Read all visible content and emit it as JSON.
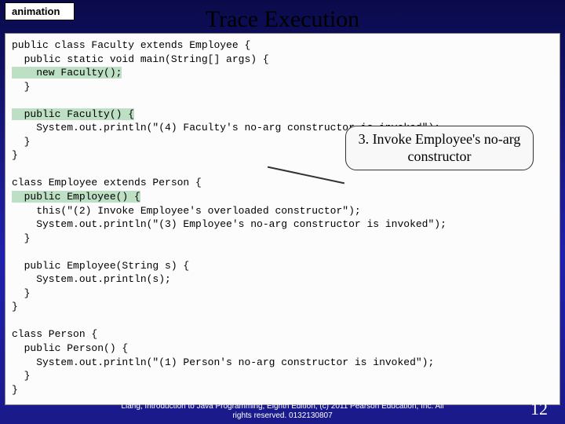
{
  "tag": "animation",
  "title": "Trace Execution",
  "code": {
    "l1a": "public class Faculty extends Employee {",
    "l1b": "  public static void main(String[] args) {",
    "l1c": "    new Faculty();",
    "l1d": "  }",
    "blank1": "",
    "l2a": "  public Faculty() {",
    "l2b": "    System.out.println(\"(4) Faculty's no-arg constructor is invoked\");",
    "l2c": "  }",
    "l2d": "}",
    "blank2": "",
    "l3a": "class Employee extends Person {",
    "l3b": "  public Employee() {",
    "l3c": "    this(\"(2) Invoke Employee's overloaded constructor\");",
    "l3d": "    System.out.println(\"(3) Employee's no-arg constructor is invoked\");",
    "l3e": "  }",
    "blank3": "",
    "l4a": "  public Employee(String s) {",
    "l4b": "    System.out.println(s);",
    "l4c": "  }",
    "l4d": "}",
    "blank4": "",
    "l5a": "class Person {",
    "l5b": "  public Person() {",
    "l5c": "    System.out.println(\"(1) Person's no-arg constructor is invoked\");",
    "l5d": "  }",
    "l5e": "}"
  },
  "callout": "3. Invoke Employee's no-arg constructor",
  "footer_l1": "Liang, Introduction to Java Programming, Eighth Edition, (c) 2011 Pearson Education, Inc. All",
  "footer_l2": "rights reserved. 0132130807",
  "page": "12"
}
